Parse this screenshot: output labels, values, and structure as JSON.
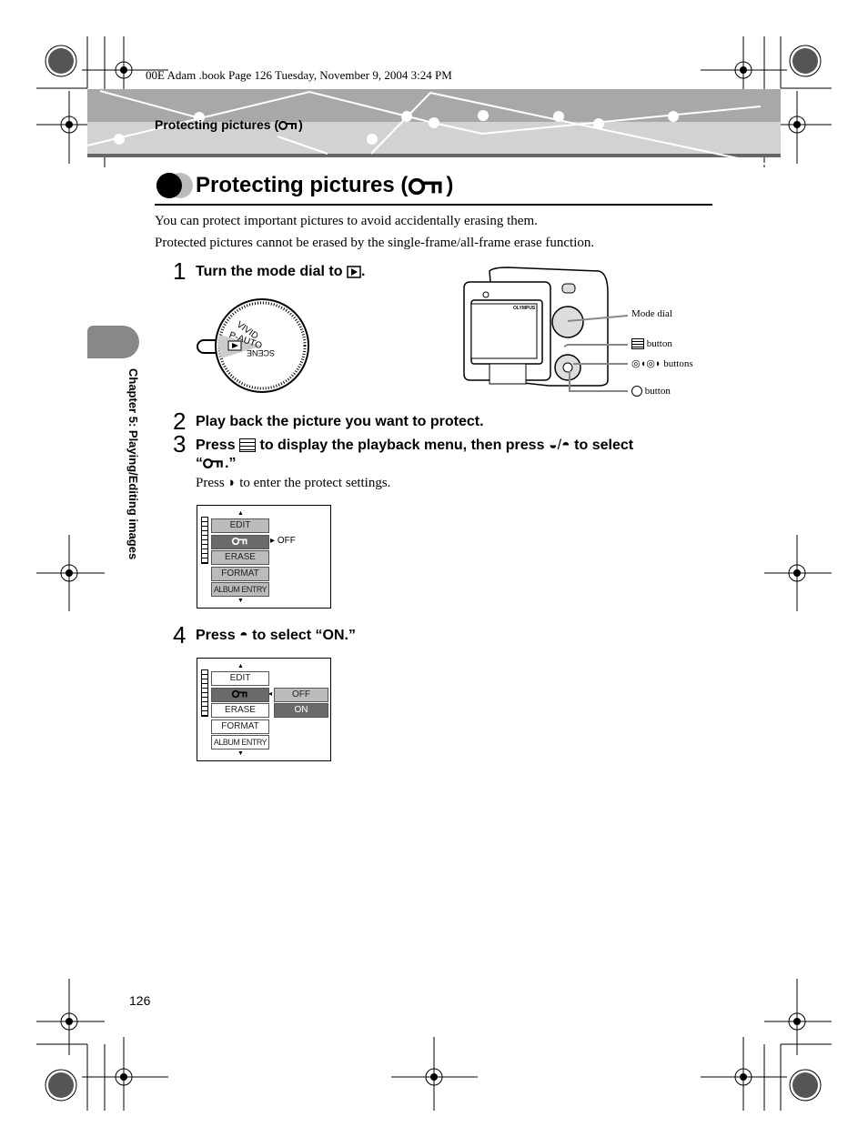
{
  "print_header": "00E Adam .book  Page 126  Tuesday, November 9, 2004  3:24 PM",
  "running_head": "Protecting pictures (",
  "title": "Protecting pictures (",
  "intro": [
    "You can protect important pictures to avoid accidentally erasing them.",
    "Protected pictures cannot be erased by the single-frame/all-frame erase function."
  ],
  "steps": [
    {
      "num": "1",
      "text": "Turn the mode dial to"
    },
    {
      "num": "2",
      "text": "Play back the picture you want to protect."
    },
    {
      "num": "3",
      "text": "Press",
      "text2": "to display the playback menu, then press",
      "text3": "to select",
      "text4": "“",
      "text5": ".”",
      "note1": "Press",
      "note2": "to enter the protect settings."
    },
    {
      "num": "4",
      "text": "Press",
      "text2": "to select “ON.”"
    }
  ],
  "dial": {
    "labels": [
      "VIVID",
      "P-AUTO",
      "SCENE"
    ]
  },
  "camera": {
    "brand": "OLYMPUS",
    "callouts": [
      "Mode dial",
      "button",
      "buttons",
      "button"
    ]
  },
  "menu1": {
    "items": [
      "EDIT",
      "",
      "ERASE",
      "FORMAT",
      "ALBUM ENTRY"
    ],
    "value": "OFF"
  },
  "menu2": {
    "items": [
      "EDIT",
      "",
      "ERASE",
      "FORMAT",
      "ALBUM ENTRY"
    ],
    "options": [
      "OFF",
      "ON"
    ],
    "selected": "ON"
  },
  "side_tab": "Chapter 5: Playing/Editing images",
  "page_number": "126",
  "colors": {
    "band_dark": "#a8a8a8",
    "band_light": "#d2d2d2",
    "menu_selected": "#6a6a6a",
    "menu_item": "#bbbbbb"
  }
}
